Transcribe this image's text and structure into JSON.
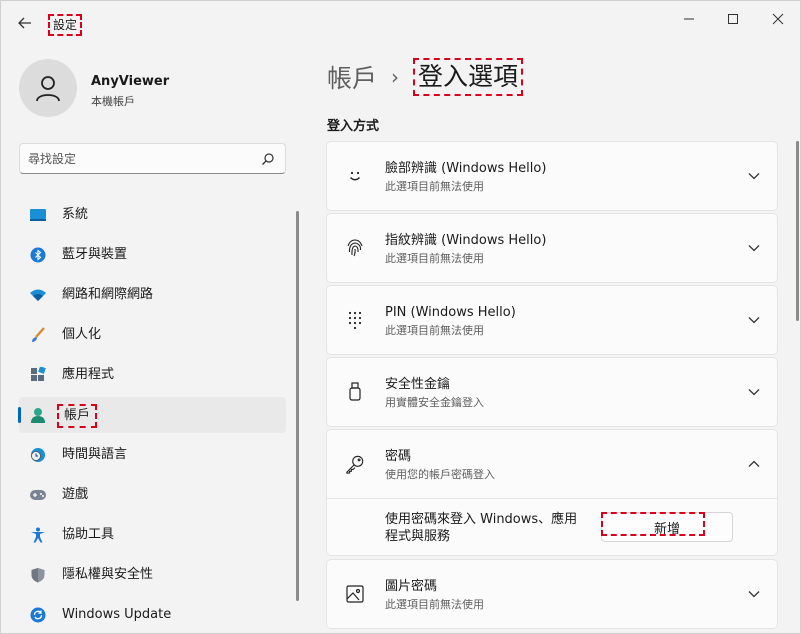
{
  "window": {
    "title": "設定"
  },
  "profile": {
    "name": "AnyViewer",
    "subtitle": "本機帳戶"
  },
  "search": {
    "placeholder": "尋找設定"
  },
  "sidebar": {
    "items": [
      {
        "label": "系統",
        "icon": "system-icon"
      },
      {
        "label": "藍牙與裝置",
        "icon": "bluetooth-icon"
      },
      {
        "label": "網路和網際網路",
        "icon": "wifi-icon"
      },
      {
        "label": "個人化",
        "icon": "brush-icon"
      },
      {
        "label": "應用程式",
        "icon": "apps-icon"
      },
      {
        "label": "帳戶",
        "icon": "accounts-icon",
        "active": true
      },
      {
        "label": "時間與語言",
        "icon": "clock-globe-icon"
      },
      {
        "label": "遊戲",
        "icon": "gamepad-icon"
      },
      {
        "label": "協助工具",
        "icon": "accessibility-icon"
      },
      {
        "label": "隱私權與安全性",
        "icon": "shield-icon"
      },
      {
        "label": "Windows Update",
        "icon": "windows-update-icon"
      }
    ]
  },
  "breadcrumb": {
    "parent": "帳戶",
    "separator": "›",
    "current": "登入選項"
  },
  "section": {
    "title": "登入方式"
  },
  "options": [
    {
      "title": "臉部辨識 (Windows Hello)",
      "subtitle": "此選項目前無法使用",
      "icon": "face-icon"
    },
    {
      "title": "指紋辨識 (Windows Hello)",
      "subtitle": "此選項目前無法使用",
      "icon": "fingerprint-icon"
    },
    {
      "title": "PIN (Windows Hello)",
      "subtitle": "此選項目前無法使用",
      "icon": "pin-keypad-icon"
    },
    {
      "title": "安全性金鑰",
      "subtitle": "用實體安全金鑰登入",
      "icon": "usb-key-icon"
    },
    {
      "title": "密碼",
      "subtitle": "使用您的帳戶密碼登入",
      "icon": "key-icon",
      "expanded": true,
      "expanded_text": "使用密碼來登入 Windows、應用程式與服務",
      "button_label": "新增"
    },
    {
      "title": "圖片密碼",
      "subtitle": "此選項目前無法使用",
      "icon": "picture-icon"
    }
  ],
  "colors": {
    "accent": "#0067c0",
    "annotation": "#d9001b"
  }
}
